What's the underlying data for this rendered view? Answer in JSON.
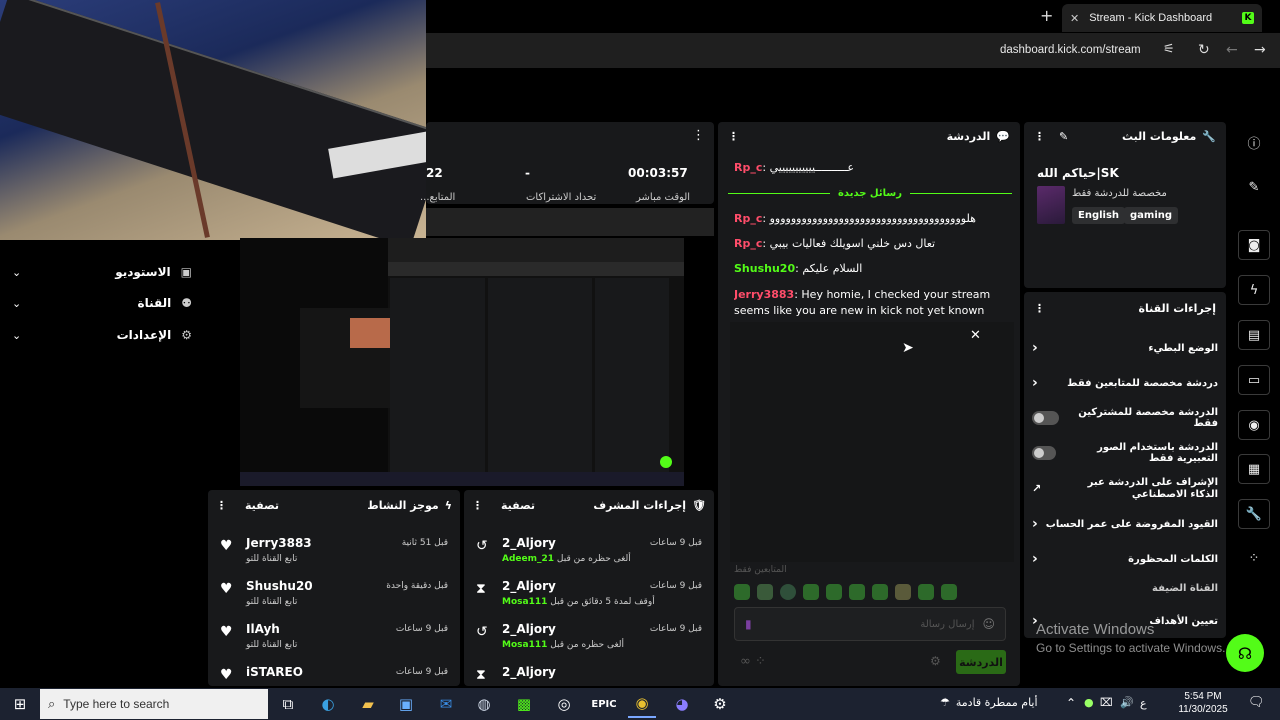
{
  "browser": {
    "tab_title": "Stream - Kick Dashboard",
    "url": "dashboard.kick.com/stream",
    "new_tab": "+",
    "close": "✕"
  },
  "stats": {
    "value1": "22",
    "value2": "-",
    "value3": "00:03:57",
    "label2": "تحداد الاشتراكات",
    "label3": "الوقت مباشر",
    "label1": "المتابع..."
  },
  "nav": {
    "items": [
      {
        "label": "الاستوديو",
        "icon": "▣"
      },
      {
        "label": "القناة",
        "icon": "⚉"
      },
      {
        "label": "الإعدادات",
        "icon": "⚙"
      }
    ]
  },
  "chat": {
    "title": "الدردشة",
    "new_messages": "رسائل جديدة",
    "messages": [
      {
        "user": "Rp_c",
        "text": "عــــــــــيييييييييييي",
        "color": "#ff4d6a"
      },
      {
        "user": "Rp_c",
        "text": "هلووووووووووووووووووووووووووووووووووووو",
        "color": "#ff4d6a"
      },
      {
        "user": "Rp_c",
        "text": "تعال دس خلني اسويلك فعاليات بيبي",
        "color": "#ff4d6a"
      },
      {
        "user": "Shushu20",
        "text": "السلام عليكم",
        "color": "#53fc18"
      },
      {
        "user": "Jerry3883",
        "text": "Hey homie, I checked your stream seems like you are new in kick not yet known and verified. I",
        "color": "#ff4d6a"
      }
    ],
    "followers_only": "المتابعين فقط",
    "input_placeholder": "إرسال رسالة",
    "send_label": "الدردشة"
  },
  "stream_info": {
    "title": "معلومات البث",
    "stream_title": "حياكم الله|SK",
    "category": "مخصصة للدردشة فقط",
    "tags": [
      "English",
      "gaming"
    ]
  },
  "channel_actions": {
    "title": "إجراءات القناة",
    "items": [
      {
        "label": "الوضع البطيء",
        "kind": "chevron"
      },
      {
        "label": "دردشة مخصصة للمتابعين فقط",
        "kind": "chevron"
      },
      {
        "label": "الدردشة مخصصة للمشتركين فقط",
        "kind": "toggle"
      },
      {
        "label": "الدردشة باستخدام الصور التعبيرية فقط",
        "kind": "toggle"
      },
      {
        "label": "الإشراف على الدردشة عبر الذكاء الاصطناعي",
        "kind": "external"
      },
      {
        "label": "القيود المفروضة على عمر الحساب",
        "kind": "chevron"
      },
      {
        "label": "الكلمات المحظورة",
        "kind": "chevron"
      }
    ],
    "guest_channel": "القناة الضيفة",
    "set_goals": "تعيين الأهداف"
  },
  "mod_actions": {
    "title": "إجراءات المشرف",
    "filter": "تصفية",
    "items": [
      {
        "user": "2_Aljory",
        "time": "قبل 9 ساعات",
        "detail_user": "21_Adeem",
        "detail": "ألغى حظره من قبل",
        "icon": "undo-icon"
      },
      {
        "user": "2_Aljory",
        "time": "قبل 9 ساعات",
        "detail_user": "Mosa111",
        "detail": "أوقف لمدة 5 دقائق من قبل",
        "icon": "hourglass-icon"
      },
      {
        "user": "2_Aljory",
        "time": "قبل 9 ساعات",
        "detail_user": "Mosa111",
        "detail": "ألغى حظره من قبل",
        "icon": "undo-icon"
      },
      {
        "user": "2_Aljory",
        "time": "",
        "detail_user": "",
        "detail": "",
        "icon": "hourglass-icon"
      }
    ]
  },
  "activity": {
    "title": "موجز النشاط",
    "filter": "تصفية",
    "items": [
      {
        "user": "Jerry3883",
        "time": "قبل 51 ثانية",
        "detail": "تابع القناة للتو"
      },
      {
        "user": "Shushu20",
        "time": "قبل دقيقة واحدة",
        "detail": "تابع القناة للتو"
      },
      {
        "user": "IlAyh",
        "time": "قبل 9 ساعات",
        "detail": "تابع القناة للتو"
      },
      {
        "user": "iSTAREO",
        "time": "قبل 9 ساعات",
        "detail": ""
      }
    ]
  },
  "watermark": {
    "line1": "Activate Windows",
    "line2": "Go to Settings to activate Windows."
  },
  "taskbar": {
    "search_placeholder": "Type here to search",
    "weather": "أيام ممطرة قادمة",
    "time": "5:54 PM",
    "date": "11/30/2025",
    "lang": "ع"
  },
  "colors": {
    "accent": "#53fc18",
    "panel": "#18191b",
    "username_red": "#ff4d6a"
  }
}
